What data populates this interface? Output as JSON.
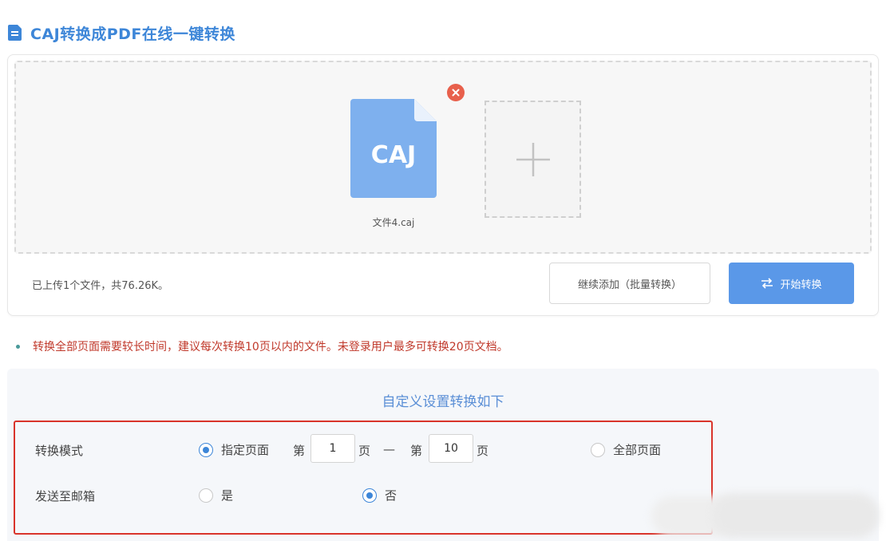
{
  "header": {
    "title": "CAJ转换成PDF在线一键转换",
    "icon": "document-icon",
    "accent_color": "#3d86d8"
  },
  "upload": {
    "file_badge": "CAJ",
    "file_name": "文件4.caj",
    "summary": "已上传1个文件，共76.26K。",
    "continue_label": "继续添加（批量转换）",
    "start_label": "开始转换",
    "start_color": "#5a98e8",
    "remove_color": "#e8604c"
  },
  "notice": "转换全部页面需要较长时间，建议每次转换10页以内的文件。未登录用户最多可转换20页文档。",
  "settings": {
    "title": "自定义设置转换如下",
    "mode": {
      "label": "转换模式",
      "option_specified": "指定页面",
      "page_prefix": "第",
      "page_suffix": "页",
      "range_separator": "—",
      "from_value": "1",
      "to_value": "10",
      "option_all": "全部页面",
      "selected": "指定页面"
    },
    "email": {
      "label": "发送至邮箱",
      "option_yes": "是",
      "option_no": "否",
      "selected": "否"
    },
    "highlight_color": "#d9342b"
  }
}
